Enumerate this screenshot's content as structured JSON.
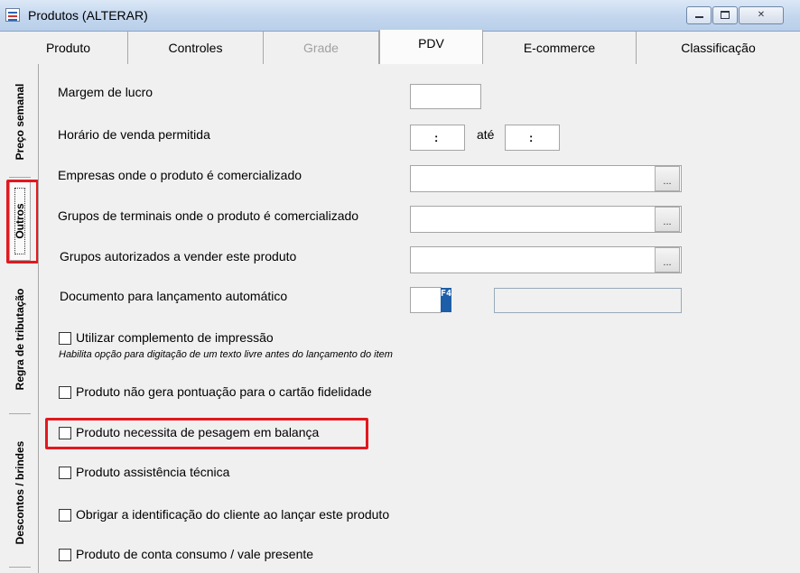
{
  "window": {
    "title": "Produtos (ALTERAR)",
    "app_icon": "application-icon",
    "controls": [
      "minimize-icon",
      "maximize-icon",
      "close-icon"
    ],
    "close_glyph": "✕"
  },
  "tabs": [
    {
      "label": "Produto",
      "state": "normal"
    },
    {
      "label": "Controles",
      "state": "normal"
    },
    {
      "label": "Grade",
      "state": "disabled"
    },
    {
      "label": "PDV",
      "state": "active"
    },
    {
      "label": "E-commerce",
      "state": "normal"
    },
    {
      "label": "Classificação",
      "state": "normal"
    }
  ],
  "side_tabs": [
    {
      "label": "Preço semanal"
    },
    {
      "label": "Outros",
      "active": true
    },
    {
      "label": "Regra de tributação"
    },
    {
      "label": "Descontos / brindes"
    }
  ],
  "form": {
    "margem_lucro": {
      "label": "Margem de lucro",
      "value": ""
    },
    "horario": {
      "label": "Horário de venda permitida",
      "from": ":",
      "connector": "até",
      "to": ":"
    },
    "empresas": {
      "label": "Empresas onde o produto é comercializado",
      "value": "",
      "button": "..."
    },
    "grupos_terminais": {
      "label": "Grupos de terminais onde o produto é comercializado",
      "value": "",
      "button": "..."
    },
    "grupos_autorizados": {
      "label": "Grupos autorizados a vender este produto",
      "value": "",
      "button": "..."
    },
    "documento": {
      "label": "Documento para lançamento automático",
      "value": "",
      "key_hint": "F4",
      "description": ""
    }
  },
  "checkboxes": [
    {
      "label": "Utilizar complemento de impressão",
      "checked": false,
      "hint": "Habilita opção para digitação de um texto livre antes do lançamento do item"
    },
    {
      "label": "Produto não gera pontuação para o cartão fidelidade",
      "checked": false
    },
    {
      "label": "Produto necessita de pesagem em balança",
      "checked": false,
      "highlighted": true
    },
    {
      "label": "Produto assistência técnica",
      "checked": false
    },
    {
      "label": "Obrigar a identificação do cliente ao lançar este produto",
      "checked": false
    },
    {
      "label": "Produto de conta consumo / vale presente",
      "checked": false
    }
  ],
  "highlight_color": "#e3171e"
}
